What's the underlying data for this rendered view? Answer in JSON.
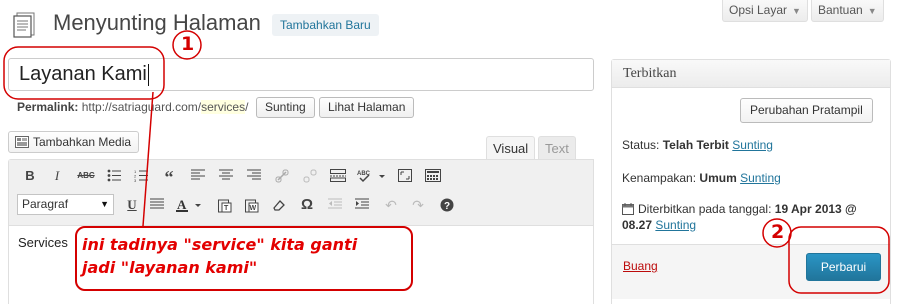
{
  "header": {
    "title": "Menyunting Halaman",
    "add_new_label": "Tambahkan Baru",
    "screen_options_label": "Opsi Layar",
    "help_label": "Bantuan"
  },
  "post": {
    "title_value": "Layanan Kami",
    "permalink_label": "Permalink:",
    "permalink_base": "http://satriaguard.com/",
    "permalink_slug": "services",
    "permalink_trailing": "/",
    "edit_slug_label": "Sunting",
    "view_page_label": "Lihat Halaman"
  },
  "editor": {
    "add_media_label": "Tambahkan Media",
    "tab_visual": "Visual",
    "tab_text": "Text",
    "format_select_value": "Paragraf",
    "content": "Services"
  },
  "publish": {
    "title": "Terbitkan",
    "preview_label": "Perubahan Pratampil",
    "status_label": "Status:",
    "status_value": "Telah Terbit",
    "visibility_label": "Kenampakan:",
    "visibility_value": "Umum",
    "published_label": "Diterbitkan pada tanggal:",
    "published_date": "19 Apr 2013 @",
    "published_time": "08.27",
    "edit_link": "Sunting",
    "trash_label": "Buang",
    "update_label": "Perbarui"
  },
  "annotations": {
    "note_line1": "ini tadinya \"service\" kita ganti",
    "note_line2": "jadi \"layanan kami\"",
    "step1": "1",
    "step2": "2",
    "color": "#d40000"
  },
  "colors": {
    "link": "#21759b",
    "primary_button": "#21759b",
    "trash": "#bc0b0b",
    "slug_highlight": "#ffffe0"
  }
}
